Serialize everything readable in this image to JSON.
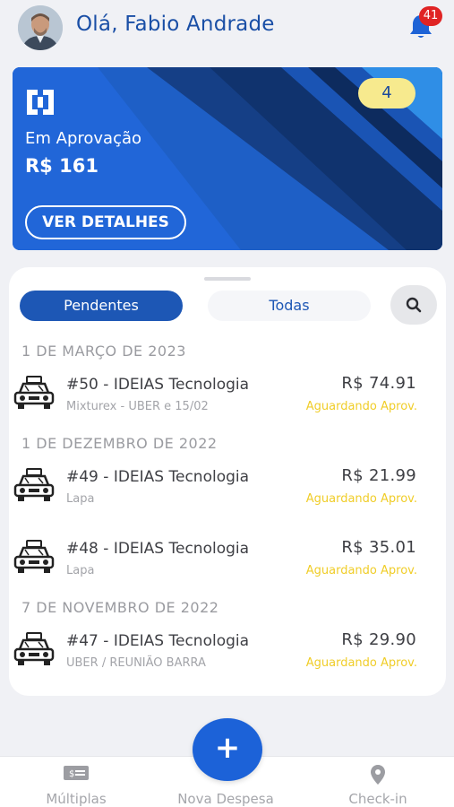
{
  "header": {
    "greeting": "Olá, Fabio Andrade",
    "notification_count": "41"
  },
  "summary_card": {
    "label": "Em Aprovação",
    "value": "R$ 161",
    "details_button": "VER DETALHES",
    "count": "4"
  },
  "tabs": {
    "pending": "Pendentes",
    "all": "Todas"
  },
  "groups": [
    {
      "date": "1 DE MARÇO DE 2023",
      "items": [
        {
          "title": "#50 - IDEIAS Tecnologia",
          "sub": "Mixturex - UBER e 15/02",
          "amount": "R$ 74.91",
          "status": "Aguardando Aprov.",
          "icon": "taxi-icon"
        }
      ]
    },
    {
      "date": "1 DE DEZEMBRO DE 2022",
      "items": [
        {
          "title": "#49 - IDEIAS Tecnologia",
          "sub": "Lapa",
          "amount": "R$ 21.99",
          "status": "Aguardando Aprov.",
          "icon": "taxi-icon"
        },
        {
          "title": "#48 - IDEIAS Tecnologia",
          "sub": "Lapa",
          "amount": "R$ 35.01",
          "status": "Aguardando Aprov.",
          "icon": "taxi-icon"
        }
      ]
    },
    {
      "date": "7 DE NOVEMBRO DE 2022",
      "items": [
        {
          "title": "#47 - IDEIAS Tecnologia",
          "sub": "UBER / REUNIÃO BARRA",
          "amount": "R$ 29.90",
          "status": "Aguardando Aprov.",
          "icon": "taxi-icon"
        }
      ]
    }
  ],
  "bottom_nav": {
    "multiple": "Múltiplas",
    "new_expense": "Nova Despesa",
    "checkin": "Check-in",
    "fab": "+"
  },
  "colors": {
    "primary": "#1d57b5",
    "status": "#f0cd28",
    "badge": "#e02424"
  }
}
